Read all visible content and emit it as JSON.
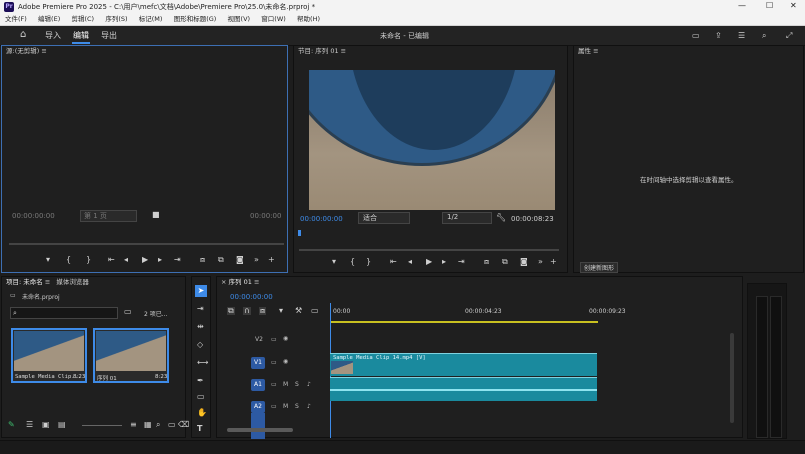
{
  "window": {
    "app_logo_text": "Pr",
    "title": "Adobe Premiere Pro 2025 - C:\\用户\\mefc\\文档\\Adobe\\Premiere Pro\\25.0\\未命名.prproj *",
    "min": "—",
    "max": "☐",
    "close": "✕"
  },
  "menu": [
    "文件(F)",
    "编辑(E)",
    "剪辑(C)",
    "序列(S)",
    "标记(M)",
    "图形和标题(G)",
    "视图(V)",
    "窗口(W)",
    "帮助(H)"
  ],
  "workspace": {
    "tabs": [
      "导入",
      "编辑",
      "导出"
    ],
    "active": "编辑",
    "doc_title": "未命名 - 已编辑"
  },
  "source": {
    "title": "源:(无剪辑)",
    "menu": "≡",
    "timecode_left": "00:00:00:00",
    "page": "第 1 页",
    "timecode_right": "00:00:00"
  },
  "program": {
    "title": "节目: 序列 01",
    "menu": "≡",
    "timecode": "00:00:00:00",
    "fit": "适合",
    "resolution": "1/2",
    "duration": "00:00:08:23"
  },
  "properties": {
    "title": "属性",
    "menu": "≡",
    "hint": "在时间轴中选择剪辑以查看属性。",
    "button": "创建新图形"
  },
  "project": {
    "tab_project": "项目: 未命名",
    "tab_media": "媒体浏览器",
    "menu": "≡",
    "breadcrumb": "未命名.prproj",
    "item_count": "2 项已...",
    "items": [
      {
        "name": "Sample Media Clip...",
        "duration": "8:23"
      },
      {
        "name": "序列 01",
        "duration": "8:23"
      }
    ]
  },
  "timeline": {
    "title": "序列 01",
    "close": "×",
    "menu": "≡",
    "timecode": "00:00:00:00",
    "ruler": [
      "00:00",
      "00:00:04:23",
      "00:00:09:23"
    ],
    "video_tracks": [
      {
        "name": "V2",
        "tag": ""
      },
      {
        "name": "V1",
        "tag": "V1"
      }
    ],
    "audio_tracks": [
      {
        "name": "A1",
        "tag": "A1"
      },
      {
        "name": "A2",
        "tag": "A2"
      }
    ],
    "clip_label": "Sample Media Clip 14.mp4 [V]"
  },
  "colors": {
    "accent": "#3e8be8",
    "clip": "#1a8a9e",
    "selection": "#2d5aa3",
    "workarea": "#c8c020"
  },
  "icons": [
    "home-icon",
    "play-icon",
    "step-back-icon",
    "step-forward-icon",
    "camera-icon",
    "wrench-icon",
    "plus-icon",
    "selection-tool-icon",
    "razor-tool-icon",
    "hand-tool-icon",
    "type-tool-icon",
    "folder-icon",
    "search-icon"
  ]
}
